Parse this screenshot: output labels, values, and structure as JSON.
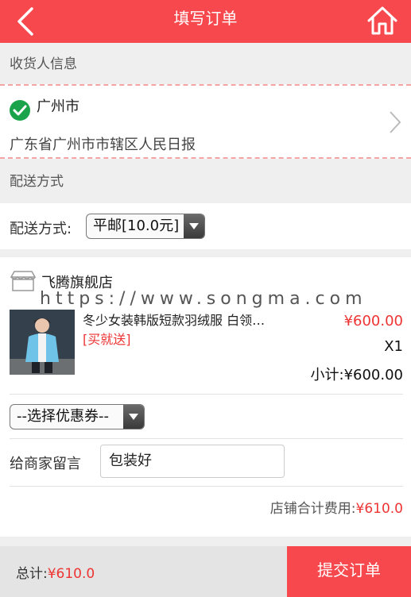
{
  "header": {
    "title": "填写订单",
    "back_icon": "chevron-left-icon",
    "home_icon": "home-icon",
    "bg_color": "#f7484e"
  },
  "receiver": {
    "section_label": "收货人信息",
    "city": "广州市",
    "address": "广东省广州市市辖区人民日报",
    "status_icon": "check-circle-icon"
  },
  "delivery": {
    "section_label": "配送方式",
    "field_label": "配送方式:",
    "selected": "平邮[10.0元]"
  },
  "shop": {
    "name": "飞腾旗舰店",
    "watermark": "https://www.songma.com",
    "product": {
      "name": "冬少女装韩版短款羽绒服 白领…",
      "tag": "[买就送]",
      "price": "¥600.00",
      "quantity": "X1",
      "subtotal": "小计:¥600.00"
    },
    "coupon_select": "--选择优惠券--",
    "message_label": "给商家留言",
    "message_value": "包装好",
    "total_label": "店铺合计费用:",
    "total_amount": "¥610.0"
  },
  "footer": {
    "total_label": "总计:",
    "total_amount": "¥610.0",
    "submit_label": "提交订单"
  }
}
